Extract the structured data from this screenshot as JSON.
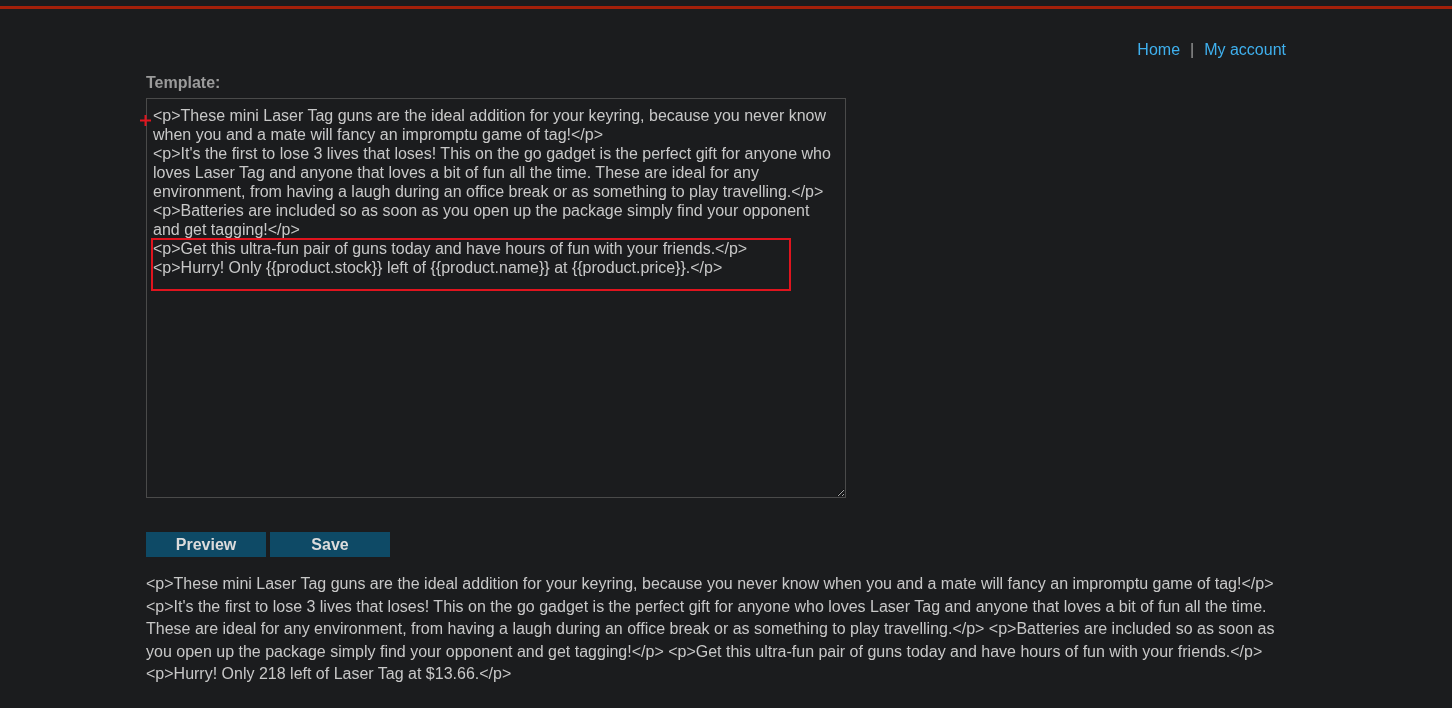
{
  "nav": [
    {
      "label": "Home"
    },
    {
      "label": "My account"
    }
  ],
  "nav_separator": "|",
  "template": {
    "label": "Template:",
    "value": "<p>These mini Laser Tag guns are the ideal addition for your keyring, because you never know when you and a mate will fancy an impromptu game of tag!</p>\n<p>It's the first to lose 3 lives that loses! This on the go gadget is the perfect gift for anyone who loves Laser Tag and anyone that loves a bit of fun all the time. These are ideal for any environment, from having a laugh during an office break or as something to play travelling.</p>\n<p>Batteries are included so as soon as you open up the package simply find your opponent and get tagging!</p>\n<p>Get this ultra-fun pair of guns today and have hours of fun with your friends.</p>\n<p>Hurry! Only {{product.stock}} left of {{product.name}} at {{product.price}}.</p>"
  },
  "buttons": [
    {
      "label": "Preview"
    },
    {
      "label": "Save"
    }
  ],
  "preview": "<p>These mini Laser Tag guns are the ideal addition for your keyring, because you never know when you and a mate will fancy an impromptu game of tag!</p> <p>It's the first to lose 3 lives that loses! This on the go gadget is the perfect gift for anyone who loves Laser Tag and anyone that loves a bit of fun all the time. These are ideal for any environment, from having a laugh during an office break or as something to play travelling.</p> <p>Batteries are included so as soon as you open up the package simply find your opponent and get tagging!</p> <p>Get this ultra-fun pair of guns today and have hours of fun with your friends.</p> <p>Hurry! Only 218 left of Laser Tag at $13.66.</p>"
}
